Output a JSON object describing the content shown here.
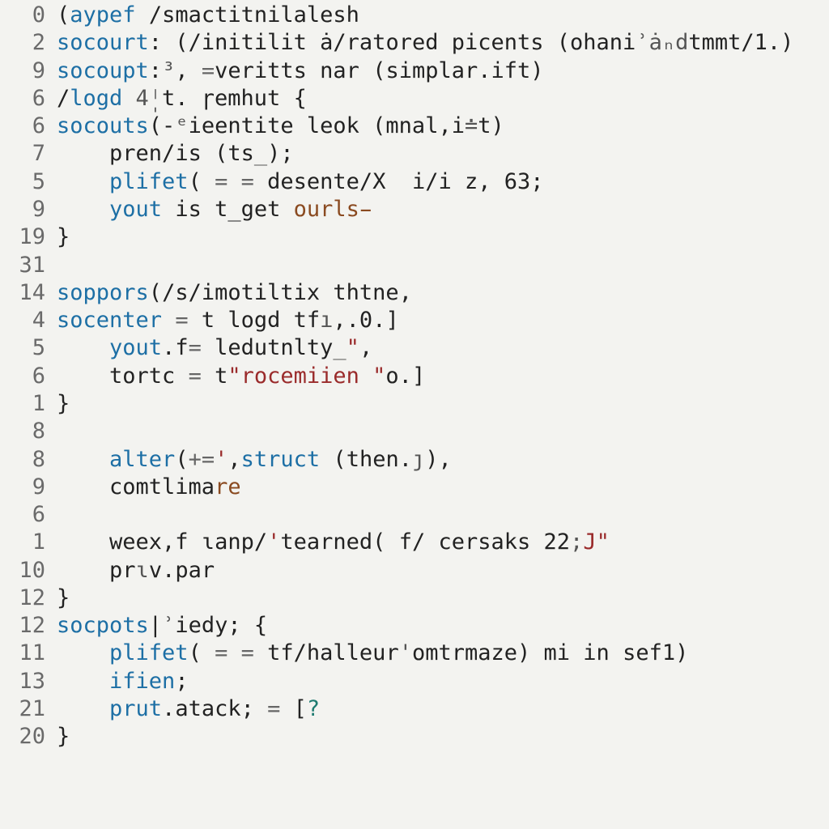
{
  "colors": {
    "background": "#f3f3f0",
    "text": "#222222",
    "keyword": "#1d6fa5",
    "string": "#9a2b2b",
    "comment": "#5a8a5a",
    "brown": "#8a4a20",
    "teal": "#1d7a70"
  },
  "lines": [
    {
      "num": "0",
      "tokens": [
        {
          "c": "par",
          "t": "("
        },
        {
          "c": "kw",
          "t": "aypef "
        },
        {
          "c": "slash",
          "t": "/"
        },
        {
          "c": "id",
          "t": "smactitnilalesh"
        }
      ]
    },
    {
      "num": "2",
      "tokens": [
        {
          "c": "kw",
          "t": "socourt"
        },
        {
          "c": "par",
          "t": ": ("
        },
        {
          "c": "slash",
          "t": "/"
        },
        {
          "c": "id",
          "t": "initilit ȧ"
        },
        {
          "c": "slash",
          "t": "/"
        },
        {
          "c": "id",
          "t": "ratored picents "
        },
        {
          "c": "par",
          "t": "("
        },
        {
          "c": "id",
          "t": "ohani"
        },
        {
          "c": "grey",
          "t": "ʾȧₙd"
        },
        {
          "c": "id",
          "t": "tmmt"
        },
        {
          "c": "slash",
          "t": "/"
        },
        {
          "c": "id",
          "t": "1."
        },
        {
          "c": "par",
          "t": ")"
        }
      ]
    },
    {
      "num": "9",
      "tokens": [
        {
          "c": "kw",
          "t": "socoupt"
        },
        {
          "c": "par",
          "t": ":"
        },
        {
          "c": "grey",
          "t": "³"
        },
        {
          "c": "par",
          "t": ", "
        },
        {
          "c": "op",
          "t": "="
        },
        {
          "c": "id",
          "t": "veritts nar "
        },
        {
          "c": "par",
          "t": "("
        },
        {
          "c": "id",
          "t": "simplar.ift"
        },
        {
          "c": "par",
          "t": ")"
        }
      ]
    },
    {
      "num": "6",
      "tokens": [
        {
          "c": "slash",
          "t": "/"
        },
        {
          "c": "kw",
          "t": "logd "
        },
        {
          "c": "grey",
          "t": "4̩"
        },
        {
          "c": "id",
          "t": "ᛌt. ɼemhut "
        },
        {
          "c": "par",
          "t": "{"
        }
      ]
    },
    {
      "num": "6",
      "tokens": [
        {
          "c": "kw",
          "t": "socouts"
        },
        {
          "c": "par",
          "t": "(-"
        },
        {
          "c": "grey",
          "t": "ᵉ"
        },
        {
          "c": "id",
          "t": "ieentite leok "
        },
        {
          "c": "par",
          "t": "("
        },
        {
          "c": "id",
          "t": "mnal,i"
        },
        {
          "c": "grey",
          "t": "≐"
        },
        {
          "c": "id",
          "t": "t"
        },
        {
          "c": "par",
          "t": ")"
        }
      ]
    },
    {
      "num": "7",
      "tokens": [
        {
          "c": "id",
          "t": "    pren"
        },
        {
          "c": "slash",
          "t": "/"
        },
        {
          "c": "id",
          "t": "is "
        },
        {
          "c": "par",
          "t": "("
        },
        {
          "c": "id",
          "t": "ts"
        },
        {
          "c": "grey",
          "t": "_"
        },
        {
          "c": "par",
          "t": ");"
        }
      ]
    },
    {
      "num": "5",
      "tokens": [
        {
          "c": "id",
          "t": "    "
        },
        {
          "c": "kw",
          "t": "plifet"
        },
        {
          "c": "par",
          "t": "( "
        },
        {
          "c": "op",
          "t": "= = "
        },
        {
          "c": "id",
          "t": "desente"
        },
        {
          "c": "slash",
          "t": "/"
        },
        {
          "c": "id",
          "t": "X  i"
        },
        {
          "c": "slash",
          "t": "/"
        },
        {
          "c": "id",
          "t": "i z, "
        },
        {
          "c": "num",
          "t": "63"
        },
        {
          "c": "par",
          "t": ";"
        }
      ]
    },
    {
      "num": "9",
      "tokens": [
        {
          "c": "id",
          "t": "    "
        },
        {
          "c": "kw",
          "t": "yout"
        },
        {
          "c": "id",
          "t": " is t_get "
        },
        {
          "c": "brown",
          "t": "ourls̵"
        }
      ]
    },
    {
      "num": "19",
      "tokens": [
        {
          "c": "par",
          "t": "}"
        }
      ]
    },
    {
      "num": "31",
      "tokens": [
        {
          "c": "par",
          "t": ""
        }
      ]
    },
    {
      "num": "14",
      "tokens": [
        {
          "c": "kw",
          "t": "soppors"
        },
        {
          "c": "par",
          "t": "("
        },
        {
          "c": "slash",
          "t": "/"
        },
        {
          "c": "id",
          "t": "s"
        },
        {
          "c": "slash",
          "t": "/"
        },
        {
          "c": "id",
          "t": "imotiltix thtne,"
        }
      ]
    },
    {
      "num": "4",
      "tokens": [
        {
          "c": "kw",
          "t": "socenter"
        },
        {
          "c": "id",
          "t": " "
        },
        {
          "c": "op",
          "t": "= "
        },
        {
          "c": "id",
          "t": "t logd tf"
        },
        {
          "c": "grey",
          "t": "ı"
        },
        {
          "c": "id",
          "t": ",."
        },
        {
          "c": "num",
          "t": "0"
        },
        {
          "c": "par",
          "t": ".]"
        }
      ]
    },
    {
      "num": "5",
      "tokens": [
        {
          "c": "id",
          "t": "    "
        },
        {
          "c": "kw",
          "t": "yout"
        },
        {
          "c": "id",
          "t": ".f"
        },
        {
          "c": "op",
          "t": "= "
        },
        {
          "c": "id",
          "t": "ledutnlty"
        },
        {
          "c": "grey",
          "t": "_"
        },
        {
          "c": "str",
          "t": "\""
        },
        {
          "c": "par",
          "t": ","
        }
      ]
    },
    {
      "num": "6",
      "tokens": [
        {
          "c": "id",
          "t": "    tortc "
        },
        {
          "c": "op",
          "t": "= "
        },
        {
          "c": "id",
          "t": "t"
        },
        {
          "c": "str",
          "t": "\"rocemiien \""
        },
        {
          "c": "id",
          "t": "o."
        },
        {
          "c": "par",
          "t": "]"
        }
      ]
    },
    {
      "num": "1",
      "tokens": [
        {
          "c": "par",
          "t": "}"
        }
      ]
    },
    {
      "num": "",
      "tokens": [
        {
          "c": "par",
          "t": ""
        }
      ]
    },
    {
      "num": "8",
      "tokens": [
        {
          "c": "par",
          "t": ""
        }
      ]
    },
    {
      "num": "8",
      "tokens": [
        {
          "c": "id",
          "t": "    "
        },
        {
          "c": "kw",
          "t": "alter"
        },
        {
          "c": "par",
          "t": "("
        },
        {
          "c": "op",
          "t": "+="
        },
        {
          "c": "str",
          "t": "'"
        },
        {
          "c": "par",
          "t": ","
        },
        {
          "c": "kw",
          "t": "struct "
        },
        {
          "c": "par",
          "t": "("
        },
        {
          "c": "id",
          "t": "then."
        },
        {
          "c": "grey",
          "t": "ȷ"
        },
        {
          "c": "par",
          "t": "),"
        }
      ]
    },
    {
      "num": "9",
      "tokens": [
        {
          "c": "id",
          "t": "    comtlima"
        },
        {
          "c": "brown",
          "t": "re"
        }
      ]
    },
    {
      "num": "6",
      "tokens": [
        {
          "c": "par",
          "t": ""
        }
      ]
    },
    {
      "num": "1",
      "tokens": [
        {
          "c": "id",
          "t": "    weex,f ɩanp"
        },
        {
          "c": "slash",
          "t": "/"
        },
        {
          "c": "str",
          "t": "'"
        },
        {
          "c": "id",
          "t": "tearned"
        },
        {
          "c": "par",
          "t": "("
        },
        {
          "c": "id",
          "t": " f"
        },
        {
          "c": "slash",
          "t": "/"
        },
        {
          "c": "id",
          "t": " cersaks "
        },
        {
          "c": "num",
          "t": "22"
        },
        {
          "c": "grey",
          "t": ";"
        },
        {
          "c": "str",
          "t": "J\""
        }
      ]
    },
    {
      "num": "10",
      "tokens": [
        {
          "c": "id",
          "t": "    pr"
        },
        {
          "c": "grey",
          "t": "ɩ"
        },
        {
          "c": "id",
          "t": "v.par"
        }
      ]
    },
    {
      "num": "12",
      "tokens": [
        {
          "c": "par",
          "t": "}"
        }
      ]
    },
    {
      "num": "12",
      "tokens": [
        {
          "c": "kw",
          "t": "socpots"
        },
        {
          "c": "par",
          "t": "|"
        },
        {
          "c": "grey",
          "t": "ʾ"
        },
        {
          "c": "id",
          "t": "iedy; "
        },
        {
          "c": "par",
          "t": "{"
        }
      ]
    },
    {
      "num": "11",
      "tokens": [
        {
          "c": "id",
          "t": "    "
        },
        {
          "c": "kw",
          "t": "plifet"
        },
        {
          "c": "par",
          "t": "( "
        },
        {
          "c": "op",
          "t": "= = "
        },
        {
          "c": "id",
          "t": "tf"
        },
        {
          "c": "slash",
          "t": "/"
        },
        {
          "c": "id",
          "t": "halleur"
        },
        {
          "c": "grey",
          "t": "'"
        },
        {
          "c": "id",
          "t": "omtrmaze"
        },
        {
          "c": "par",
          "t": ") "
        },
        {
          "c": "id",
          "t": "mi in sef1"
        },
        {
          "c": "par",
          "t": ")"
        }
      ]
    },
    {
      "num": "13",
      "tokens": [
        {
          "c": "id",
          "t": "    "
        },
        {
          "c": "kw",
          "t": "ifien"
        },
        {
          "c": "par",
          "t": ";"
        }
      ]
    },
    {
      "num": "21",
      "tokens": [
        {
          "c": "id",
          "t": "    "
        },
        {
          "c": "kw",
          "t": "prut"
        },
        {
          "c": "id",
          "t": ".atack; "
        },
        {
          "c": "op",
          "t": "= "
        },
        {
          "c": "par",
          "t": "["
        },
        {
          "c": "teal",
          "t": "?"
        }
      ]
    },
    {
      "num": "20",
      "tokens": [
        {
          "c": "par",
          "t": "}"
        }
      ]
    }
  ]
}
